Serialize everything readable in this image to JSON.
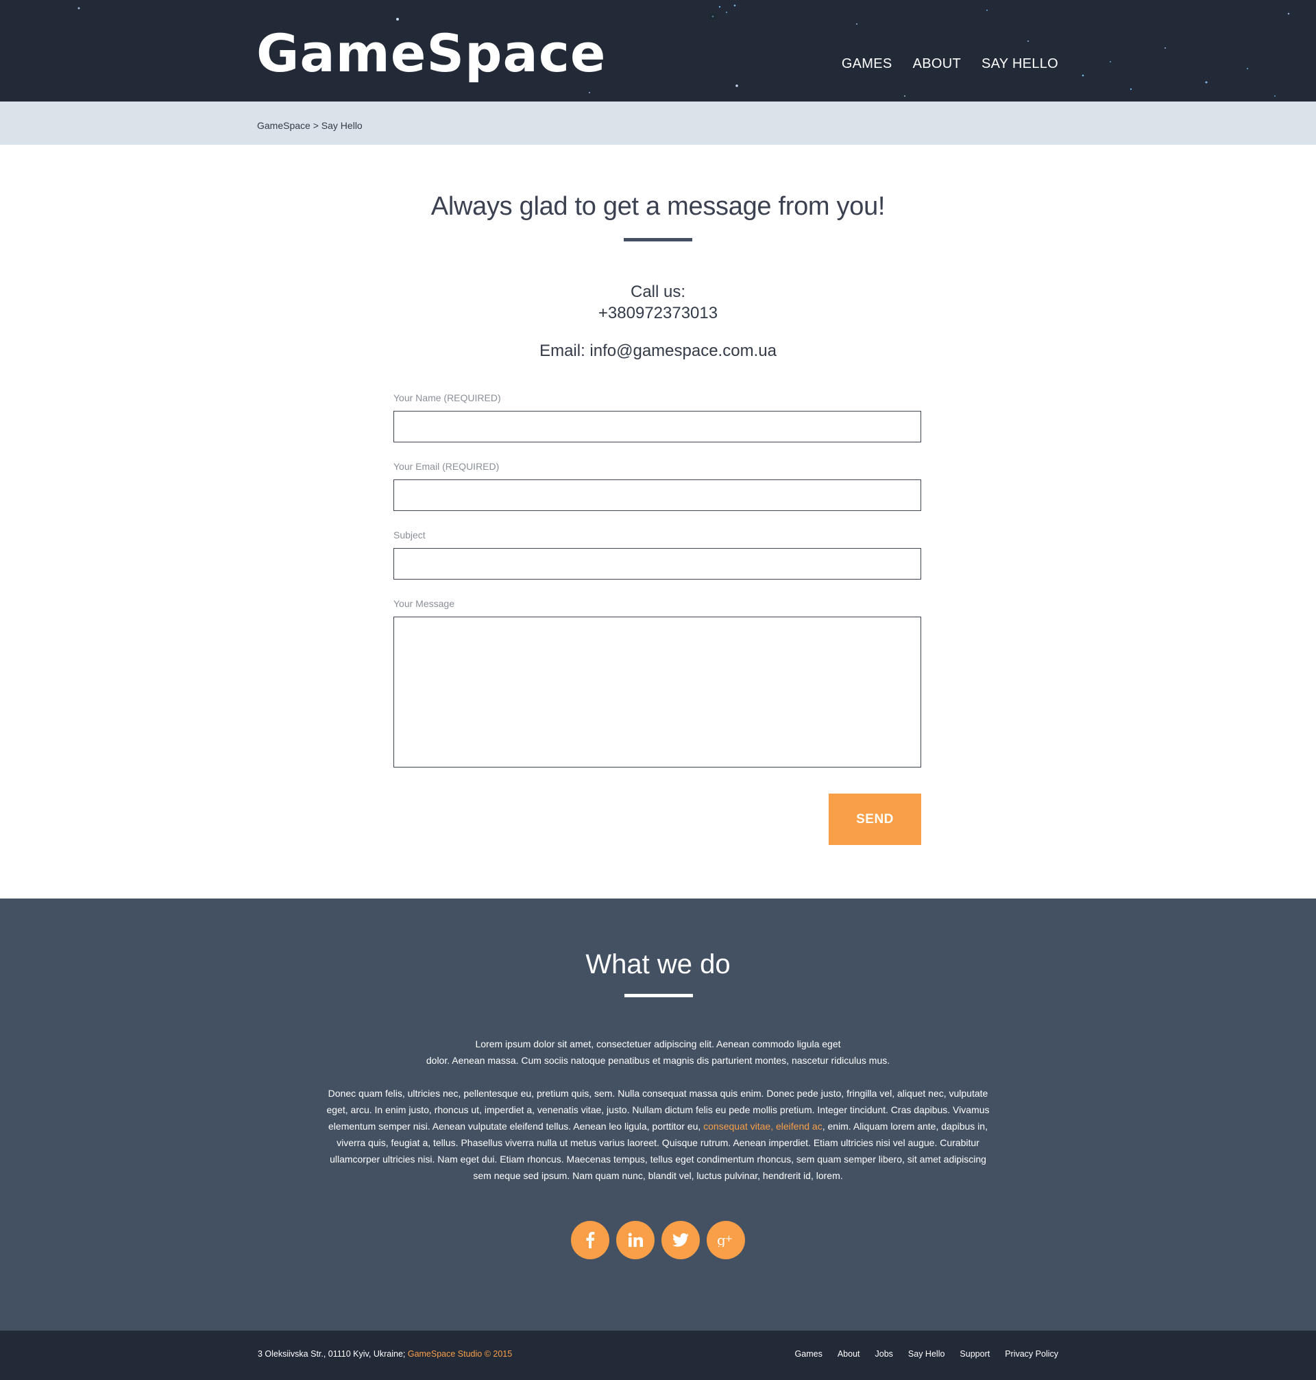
{
  "header": {
    "logo": "GameSpace",
    "nav": [
      "GAMES",
      "ABOUT",
      "SAY HELLO"
    ]
  },
  "breadcrumb": {
    "home": "GameSpace",
    "separator": ">",
    "current": "Say Hello"
  },
  "contact": {
    "title": "Always glad to get a message from you!",
    "call_label": "Call us:",
    "phone": "+380972373013",
    "email": "Email: info@gamespace.com.ua"
  },
  "form": {
    "name_label": "Your Name (REQUIRED)",
    "name_value": "",
    "email_label": "Your Email (REQUIRED)",
    "email_value": "",
    "subject_label": "Subject",
    "subject_value": "",
    "message_label": "Your Message",
    "message_value": "",
    "send_label": "SEND"
  },
  "what_we_do": {
    "title": "What we do",
    "p1_line1": "Lorem ipsum dolor sit amet, consectetuer adipiscing elit. Aenean commodo ligula eget",
    "p1_line2": "dolor. Aenean massa. Cum sociis natoque penatibus et magnis dis parturient montes, nascetur ridiculus mus.",
    "p2_before": "Donec quam felis, ultricies nec, pellentesque eu, pretium quis, sem. Nulla consequat massa quis enim. Donec pede justo, fringilla vel, aliquet nec, vulputate eget, arcu. In enim justo, rhoncus ut, imperdiet a, venenatis vitae, justo. Nullam dictum felis eu pede mollis pretium. Integer tincidunt. Cras dapibus. Vivamus elementum semper nisi. Aenean vulputate eleifend tellus. Aenean leo ligula, porttitor eu, ",
    "p2_link": "consequat vitae, eleifend ac",
    "p2_after": ", enim. Aliquam lorem ante, dapibus in, viverra quis, feugiat a, tellus. Phasellus viverra nulla ut metus varius laoreet. Quisque rutrum. Aenean imperdiet. Etiam ultricies nisi vel augue. Curabitur ullamcorper ultricies nisi. Nam eget dui. Etiam rhoncus. Maecenas tempus, tellus eget condimentum rhoncus, sem quam semper libero, sit amet adipiscing sem neque sed ipsum. Nam quam nunc, blandit vel, luctus pulvinar, hendrerit id, lorem.",
    "socials": [
      "facebook-icon",
      "linkedin-icon",
      "twitter-icon",
      "google-plus-icon"
    ]
  },
  "footer": {
    "address": "3 Oleksiivska Str., 01110 Kyiv, Ukraine; ",
    "studio": "GameSpace Studio © 2015",
    "links": [
      "Games",
      "About",
      "Jobs",
      "Say Hello",
      "Support",
      "Privacy Policy"
    ]
  },
  "colors": {
    "header_bg": "#222937",
    "breadcrumb_bg": "#dae3e9",
    "accent": "#f89f48",
    "section_bg": "#445163"
  }
}
